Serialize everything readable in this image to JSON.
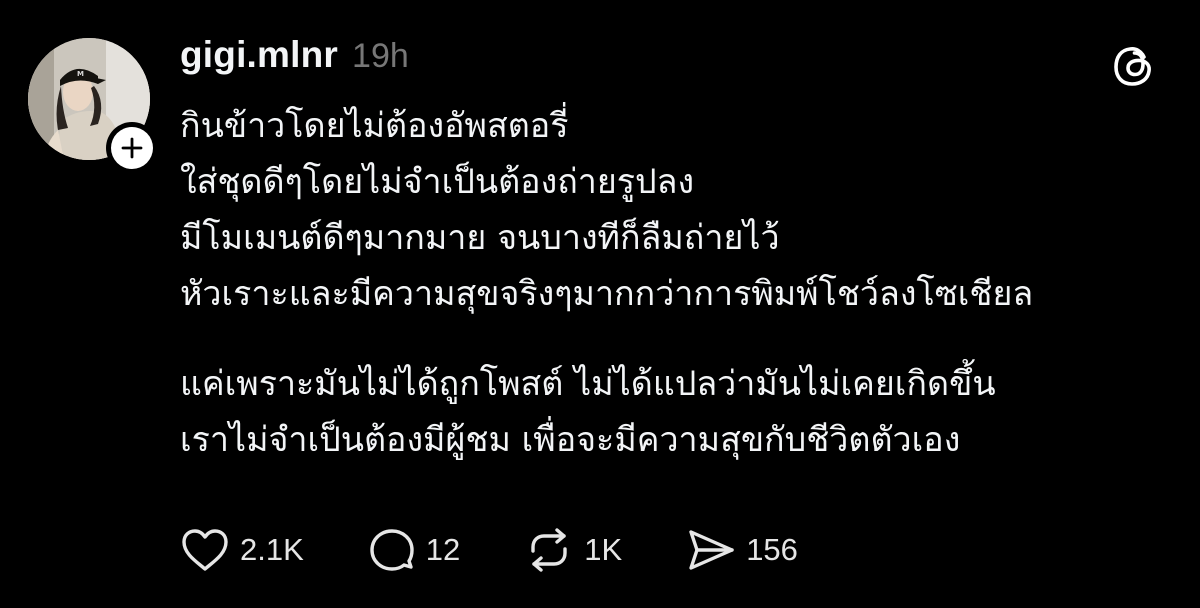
{
  "post": {
    "username": "gigi.mlnr",
    "timestamp": "19h",
    "lines": [
      "กินข้าวโดยไม่ต้องอัพสตอรี่",
      "ใส่ชุดดีๆโดยไม่จำเป็นต้องถ่ายรูปลง",
      "มีโมเมนต์ดีๆมากมาย จนบางทีก็ลืมถ่ายไว้",
      "หัวเราะและมีความสุขจริงๆมากกว่าการพิมพ์โชว์ลงโซเชียล"
    ],
    "lines2": [
      "แค่เพราะมันไม่ได้ถูกโพสต์ ไม่ได้แปลว่ามันไม่เคยเกิดขึ้น",
      "เราไม่จำเป็นต้องมีผู้ชม เพื่อจะมีความสุขกับชีวิตตัวเอง"
    ]
  },
  "actions": {
    "likes": "2.1K",
    "replies": "12",
    "reposts": "1K",
    "shares": "156"
  },
  "icons": {
    "follow": "plus-icon",
    "brand": "threads-logo-icon",
    "like": "heart-icon",
    "reply": "comment-icon",
    "repost": "repost-icon",
    "share": "send-icon"
  },
  "colors": {
    "background": "#000000",
    "text": "#f3f5f7",
    "muted": "#777777"
  }
}
